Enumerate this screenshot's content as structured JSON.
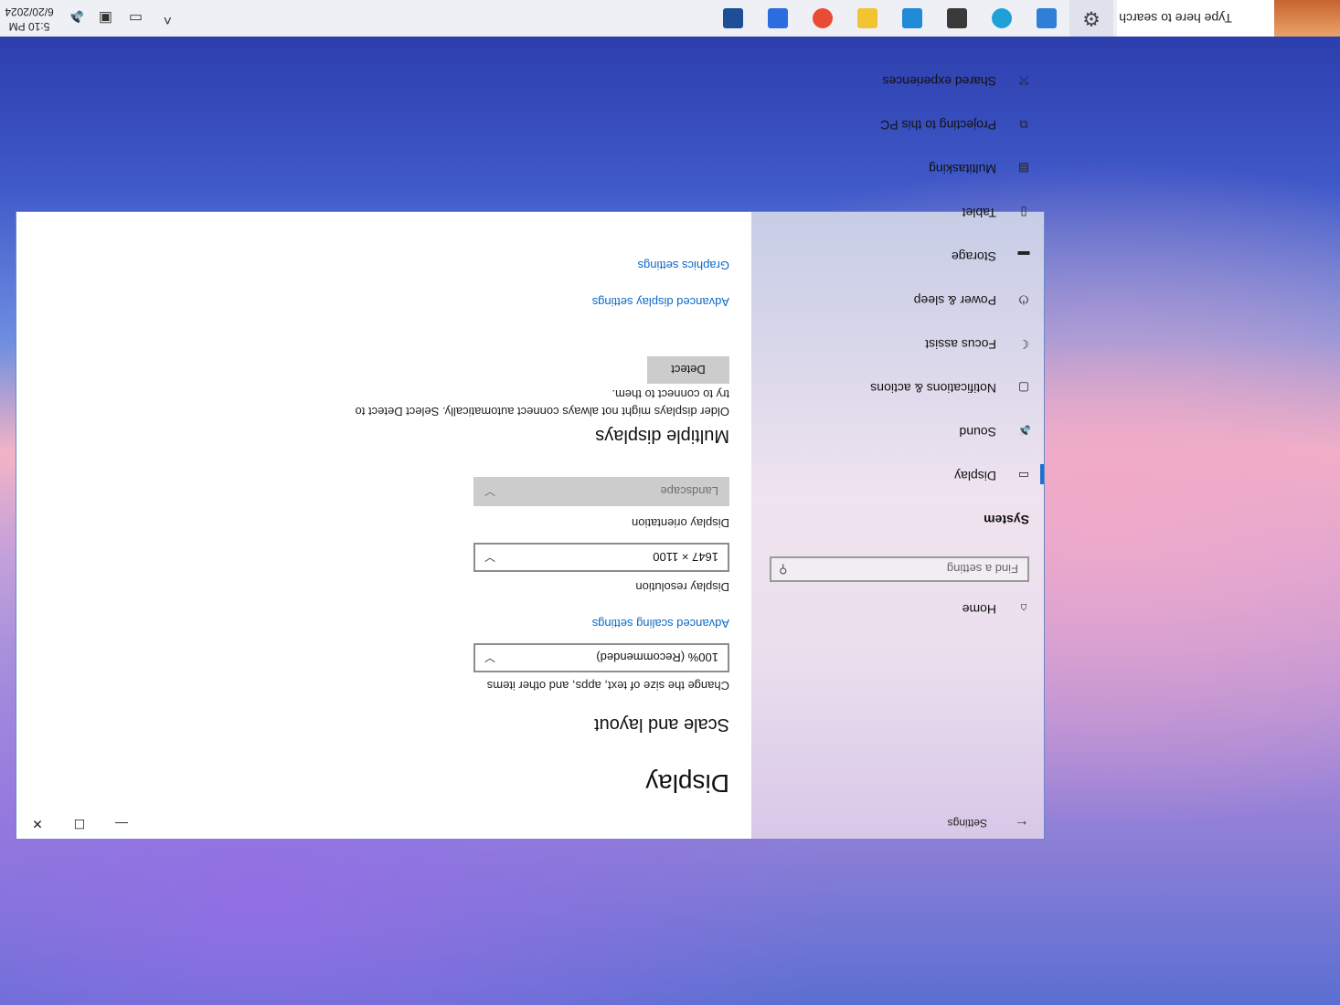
{
  "taskbar": {
    "search_placeholder": "Type here to search",
    "apps": [
      {
        "name": "settings",
        "color": "#444444"
      },
      {
        "name": "control-panel",
        "color": "#2f7fd8"
      },
      {
        "name": "edge",
        "color": "#1fa0d8"
      },
      {
        "name": "media-player",
        "color": "#3a3a3a"
      },
      {
        "name": "vscode",
        "color": "#1f8ad6"
      },
      {
        "name": "python",
        "color": "#f2c431"
      },
      {
        "name": "chrome",
        "color": "#e94b35"
      },
      {
        "name": "todo",
        "color": "#2b6de0"
      },
      {
        "name": "store",
        "color": "#1d4f96"
      }
    ],
    "clock_time": "5:10 PM",
    "clock_date": "6/20/2024"
  },
  "window": {
    "app_title": "Settings",
    "nav": {
      "home_label": "Home",
      "search_placeholder": "Find a setting",
      "section": "System",
      "items": [
        {
          "label": "Display",
          "icon": "monitor-icon",
          "selected": true
        },
        {
          "label": "Sound",
          "icon": "speaker-icon"
        },
        {
          "label": "Notifications & actions",
          "icon": "notification-icon"
        },
        {
          "label": "Focus assist",
          "icon": "moon-icon"
        },
        {
          "label": "Power & sleep",
          "icon": "power-icon"
        },
        {
          "label": "Storage",
          "icon": "storage-icon"
        },
        {
          "label": "Tablet",
          "icon": "tablet-icon"
        },
        {
          "label": "Multitasking",
          "icon": "multitasking-icon"
        },
        {
          "label": "Projecting to this PC",
          "icon": "projecting-icon"
        },
        {
          "label": "Shared experiences",
          "icon": "shared-icon"
        }
      ]
    },
    "content": {
      "page_title": "Display",
      "scale_heading": "Scale and layout",
      "scale_label": "Change the size of text, apps, and other items",
      "scale_value": "100% (Recommended)",
      "advanced_scaling_link": "Advanced scaling settings",
      "resolution_label": "Display resolution",
      "resolution_value": "1647 × 1100",
      "orientation_label": "Display orientation",
      "orientation_value": "Landscape",
      "multiple_heading": "Multiple displays",
      "multiple_text_line1": "Older displays might not always connect automatically. Select Detect to",
      "multiple_text_line2": "try to connect to them.",
      "detect_button": "Detect",
      "advanced_display_link": "Advanced display settings",
      "graphics_link": "Graphics settings"
    }
  }
}
